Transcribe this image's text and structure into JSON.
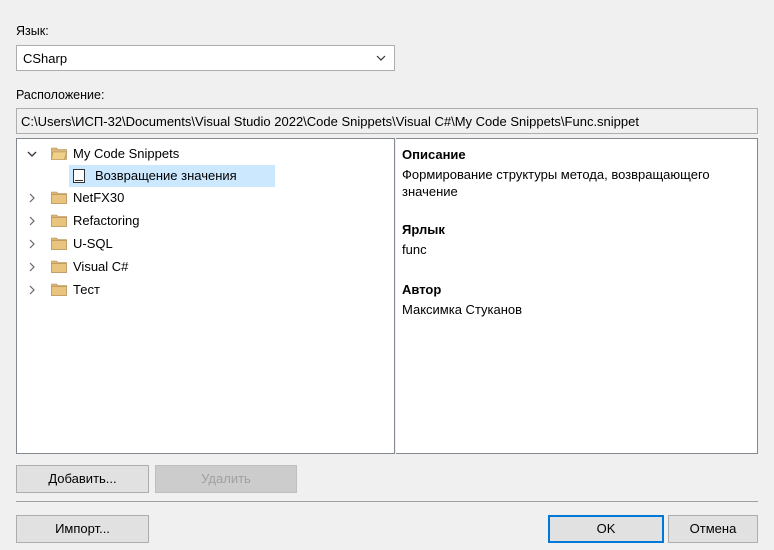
{
  "language": {
    "label": "Язык:",
    "value": "CSharp"
  },
  "location": {
    "label": "Расположение:",
    "path": "C:\\Users\\ИСП-32\\Documents\\Visual Studio 2022\\Code Snippets\\Visual C#\\My Code Snippets\\Func.snippet"
  },
  "tree": {
    "items": [
      {
        "label": "My Code Snippets",
        "expanded": true
      },
      {
        "label": "Возвращение значения"
      },
      {
        "label": "NetFX30"
      },
      {
        "label": "Refactoring"
      },
      {
        "label": "U-SQL"
      },
      {
        "label": "Visual C#"
      },
      {
        "label": "Тест"
      }
    ]
  },
  "details": {
    "description_label": "Описание",
    "description_value": "Формирование структуры метода, возвращающего значение",
    "shortcut_label": "Ярлык",
    "shortcut_value": "func",
    "author_label": "Автор",
    "author_value": "Максимка Стуканов"
  },
  "buttons": {
    "add": "Добавить...",
    "delete": "Удалить",
    "import": "Импорт...",
    "ok": "OK",
    "cancel": "Отмена"
  },
  "colors": {
    "selection": "#cce8ff",
    "folder": "#dcb67a",
    "accent": "#0078d7"
  }
}
